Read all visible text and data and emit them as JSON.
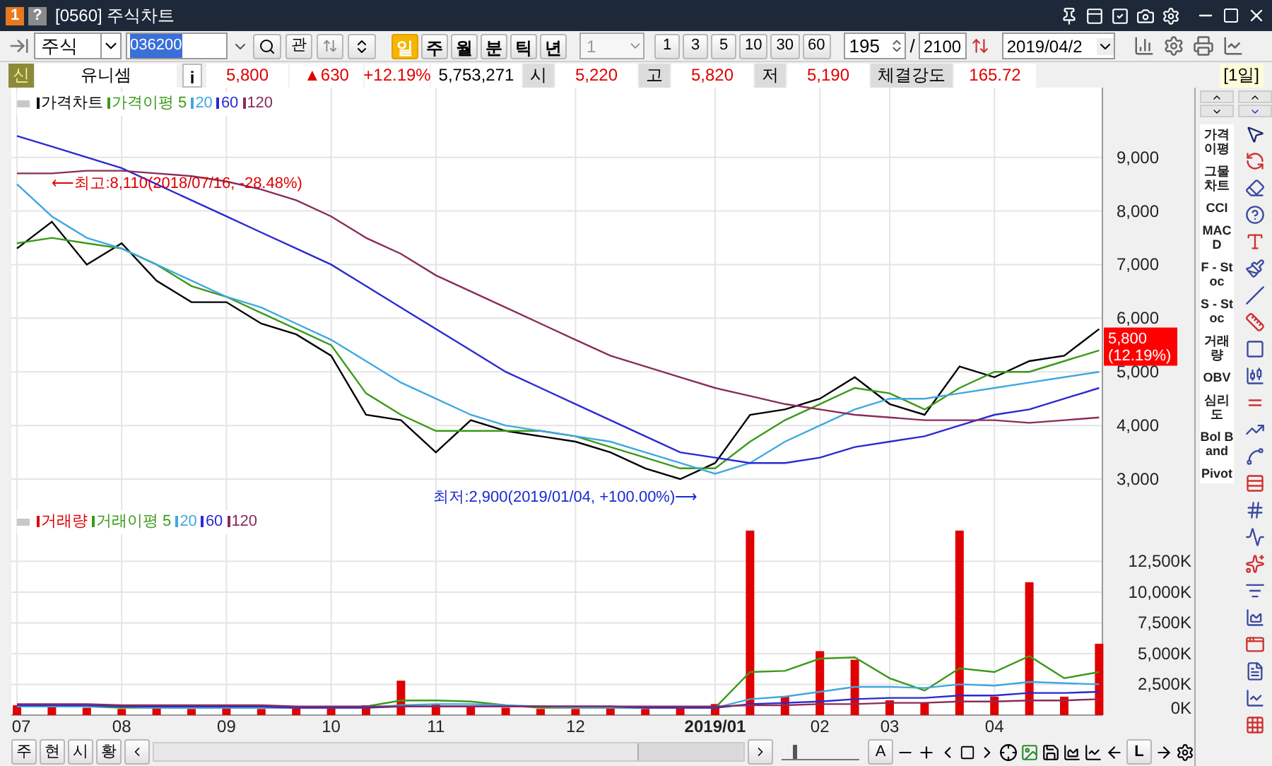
{
  "window": {
    "badge": "1",
    "help": "?",
    "title": "[0560] 주식차트"
  },
  "toolbar": {
    "market": "주식",
    "code": "036200",
    "related": "관",
    "periods": [
      {
        "label": "일",
        "selected": true
      },
      {
        "label": "주",
        "selected": false
      },
      {
        "label": "월",
        "selected": false
      },
      {
        "label": "분",
        "selected": false
      },
      {
        "label": "틱",
        "selected": false
      },
      {
        "label": "년",
        "selected": false
      }
    ],
    "interval": "1",
    "interval_buttons": [
      "1",
      "3",
      "5",
      "10",
      "30",
      "60"
    ],
    "count": "195",
    "separator": "/",
    "total": "2100",
    "date": "2019/04/2"
  },
  "quote": {
    "market_badge": "신",
    "name": "유니셈",
    "info": "i",
    "price": "5,800",
    "change": "▲630",
    "rate": "+12.19%",
    "volume": "5,753,271",
    "fields": [
      {
        "label": "시",
        "value": "5,220"
      },
      {
        "label": "고",
        "value": "5,820"
      },
      {
        "label": "저",
        "value": "5,190"
      },
      {
        "label": "체결강도",
        "value": "165.72"
      }
    ],
    "period": "[1일]"
  },
  "price_chart": {
    "last_price": "5,800",
    "last_rate": "(12.19%)",
    "chart_data": {
      "type": "line",
      "grid": true,
      "categories": [
        null,
        null,
        null,
        null,
        null,
        null,
        null,
        null,
        null,
        null,
        null,
        null,
        null,
        null,
        null,
        null,
        null,
        null,
        null,
        null,
        null,
        null,
        null,
        null,
        null,
        null,
        null,
        null,
        null,
        null,
        null,
        null
      ],
      "ylim": [
        2500,
        10300
      ],
      "yticks": [
        {
          "value": 3000,
          "label": "3,000"
        },
        {
          "value": 4000,
          "label": "4,000"
        },
        {
          "value": 5000,
          "label": "5,000"
        },
        {
          "value": 6000,
          "label": "6,000"
        },
        {
          "value": 7000,
          "label": "7,000"
        },
        {
          "value": 8000,
          "label": "8,000"
        },
        {
          "value": 9000,
          "label": "9,000"
        }
      ],
      "series": [
        {
          "name": "가격차트",
          "color": "#000000",
          "values": [
            7300,
            7800,
            7000,
            7400,
            6700,
            6300,
            6300,
            5900,
            5700,
            5300,
            4200,
            4100,
            3500,
            4100,
            3900,
            3800,
            3700,
            3500,
            3200,
            3000,
            3300,
            4200,
            4300,
            4500,
            4900,
            4400,
            4200,
            5100,
            4900,
            5200,
            5300,
            5800
          ]
        },
        {
          "name": "가격이평 5",
          "color": "#3a9a1a",
          "values": [
            7400,
            7500,
            7400,
            7300,
            7000,
            6600,
            6400,
            6100,
            5800,
            5500,
            4600,
            4200,
            3900,
            3900,
            3900,
            3900,
            3800,
            3600,
            3400,
            3200,
            3200,
            3700,
            4100,
            4400,
            4700,
            4600,
            4300,
            4700,
            5000,
            5000,
            5200,
            5400
          ]
        },
        {
          "name": "20",
          "color": "#3fa8e0",
          "values": [
            8500,
            7900,
            7500,
            7300,
            7000,
            6700,
            6400,
            6200,
            5900,
            5600,
            5200,
            4800,
            4500,
            4200,
            4000,
            3900,
            3800,
            3700,
            3500,
            3300,
            3100,
            3300,
            3700,
            4000,
            4300,
            4500,
            4500,
            4600,
            4700,
            4800,
            4900,
            5000
          ]
        },
        {
          "name": "60",
          "color": "#2a2ad0",
          "values": [
            9400,
            9200,
            9000,
            8800,
            8500,
            8200,
            7900,
            7600,
            7300,
            7000,
            6600,
            6200,
            5800,
            5400,
            5000,
            4700,
            4400,
            4100,
            3800,
            3500,
            3400,
            3300,
            3300,
            3400,
            3600,
            3700,
            3800,
            4000,
            4200,
            4300,
            4500,
            4700
          ]
        },
        {
          "name": "120",
          "color": "#8a2c5a",
          "values": [
            8700,
            8700,
            8750,
            8750,
            8700,
            8650,
            8550,
            8400,
            8200,
            7900,
            7500,
            7200,
            6800,
            6500,
            6200,
            5900,
            5600,
            5300,
            5100,
            4900,
            4700,
            4550,
            4400,
            4300,
            4200,
            4150,
            4100,
            4100,
            4100,
            4050,
            4100,
            4150
          ]
        }
      ],
      "annotations": [
        {
          "text": "⟵최고:8,110(2018/07/16, -28.48%)"
        },
        {
          "text": "최저:2,900(2019/01/04, +100.00%)⟶"
        }
      ]
    }
  },
  "volume_chart": {
    "chart_data": {
      "type": "bar",
      "grid": true,
      "categories": [
        "07",
        null,
        null,
        "08",
        null,
        null,
        "09",
        null,
        null,
        "10",
        null,
        null,
        "11",
        null,
        null,
        null,
        "12",
        null,
        null,
        null,
        "2019/01",
        null,
        null,
        "02",
        null,
        "03",
        null,
        null,
        "04",
        null,
        null,
        null
      ],
      "ylim": [
        0,
        17000
      ],
      "yticks": [
        {
          "value": 0,
          "label": "0K"
        },
        {
          "value": 2500,
          "label": "2,500K"
        },
        {
          "value": 5000,
          "label": "5,000K"
        },
        {
          "value": 7500,
          "label": "7,500K"
        },
        {
          "value": 10000,
          "label": "10,000K"
        },
        {
          "value": 12500,
          "label": "12,500K"
        }
      ],
      "series": [
        {
          "name": "거래량",
          "color": "#e00000",
          "values": [
            800,
            700,
            600,
            500,
            600,
            500,
            600,
            500,
            600,
            700,
            800,
            2800,
            900,
            700,
            600,
            500,
            500,
            600,
            500,
            600,
            900,
            15000,
            1500,
            5200,
            4500,
            1200,
            1000,
            15000,
            1500,
            10800,
            1500,
            5800
          ]
        },
        {
          "name": "거래이평 5",
          "color": "#3a9a1a",
          "type": "line",
          "values": [
            700,
            700,
            700,
            600,
            600,
            600,
            600,
            600,
            600,
            600,
            700,
            1200,
            1200,
            1100,
            800,
            600,
            600,
            600,
            600,
            600,
            600,
            3500,
            3600,
            4600,
            4700,
            3000,
            2000,
            3800,
            3500,
            4800,
            3000,
            3500
          ]
        },
        {
          "name": "20",
          "color": "#3fa8e0",
          "type": "line",
          "values": [
            700,
            700,
            700,
            700,
            600,
            600,
            600,
            600,
            600,
            600,
            600,
            800,
            900,
            900,
            800,
            700,
            600,
            600,
            600,
            600,
            600,
            1300,
            1500,
            1900,
            2300,
            2300,
            2200,
            2500,
            2400,
            2700,
            2600,
            2500
          ]
        },
        {
          "name": "60",
          "color": "#2a2ad0",
          "type": "line",
          "values": [
            800,
            800,
            800,
            700,
            700,
            700,
            700,
            700,
            600,
            600,
            600,
            700,
            700,
            700,
            700,
            700,
            700,
            700,
            600,
            600,
            600,
            900,
            1000,
            1100,
            1300,
            1400,
            1400,
            1600,
            1600,
            1800,
            1800,
            1900
          ]
        },
        {
          "name": "120",
          "color": "#8a2c5a",
          "type": "line",
          "values": [
            900,
            900,
            900,
            800,
            800,
            800,
            800,
            800,
            700,
            700,
            700,
            700,
            700,
            700,
            700,
            700,
            700,
            700,
            700,
            700,
            700,
            800,
            800,
            900,
            900,
            1000,
            1000,
            1100,
            1100,
            1200,
            1200,
            1300
          ]
        }
      ]
    }
  },
  "bottom_bar": {
    "tabs": [
      "주",
      "현",
      "시",
      "황"
    ],
    "letter_buttons": [
      "A",
      "L"
    ],
    "zoom_slider": {
      "level": 0.15
    }
  },
  "indicators": [
    "가격이평",
    "그물차트",
    "CCI",
    "MACD",
    "F - Stoc",
    "S - Stoc",
    "거래량",
    "OBV",
    "심리도",
    "Bol Band",
    "Pivot"
  ]
}
